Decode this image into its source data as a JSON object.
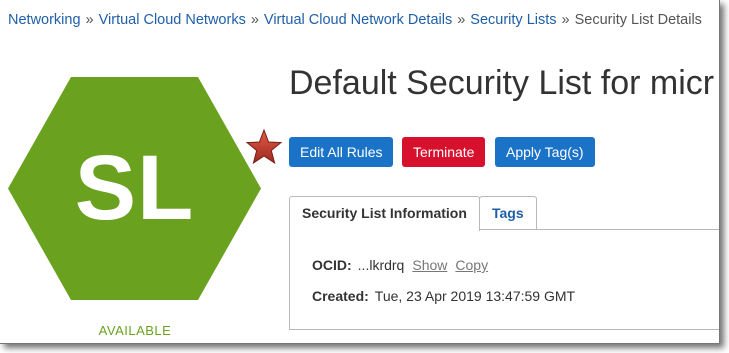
{
  "breadcrumb": {
    "items": [
      "Networking",
      "Virtual Cloud Networks",
      "Virtual Cloud Network Details",
      "Security Lists"
    ],
    "separator": "»",
    "current": "Security List Details"
  },
  "resource": {
    "initials": "SL",
    "status": "AVAILABLE",
    "title": "Default Security List for micr",
    "color": "#6aa21f"
  },
  "actions": {
    "edit_label": "Edit All Rules",
    "terminate_label": "Terminate",
    "apply_tag_label": "Apply Tag(s)"
  },
  "tabs": [
    {
      "label": "Security List Information"
    },
    {
      "label": "Tags"
    }
  ],
  "info": {
    "ocid_label": "OCID:",
    "ocid_value": "...lkrdrq",
    "show_label": "Show",
    "copy_label": "Copy",
    "created_label": "Created:",
    "created_value": "Tue, 23 Apr 2019 13:47:59 GMT"
  },
  "annotation": {
    "icon": "star-icon",
    "color": "#c8352a"
  }
}
